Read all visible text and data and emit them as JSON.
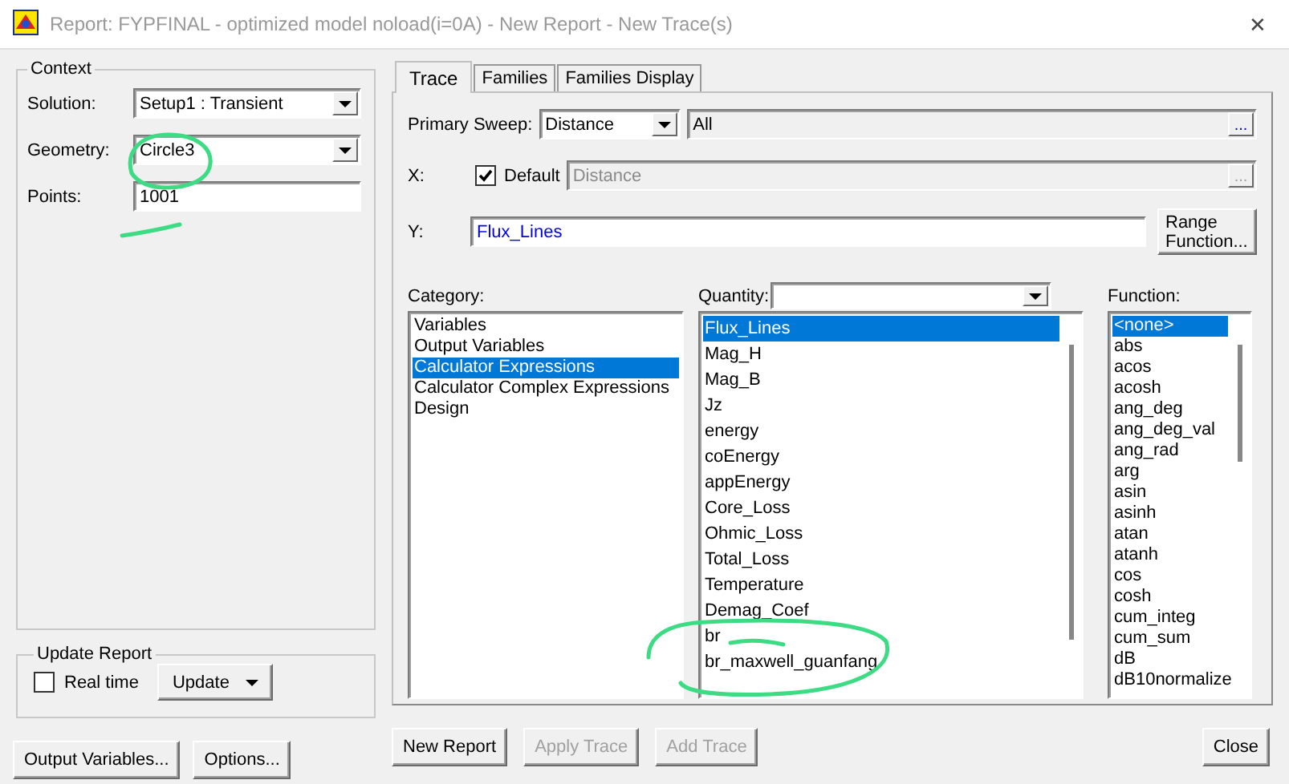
{
  "window": {
    "title": "Report: FYPFINAL - optimized model noload(i=0A) - New Report - New Trace(s)",
    "close": "✕"
  },
  "context": {
    "title": "Context",
    "fields": [
      {
        "label": "Solution:",
        "value": "Setup1 : Transient",
        "kind": "dropdown"
      },
      {
        "label": "Geometry:",
        "value": "Circle3",
        "kind": "dropdown"
      },
      {
        "label": "Points:",
        "value": "1001",
        "kind": "text"
      }
    ]
  },
  "update_report": {
    "title": "Update Report",
    "real_time": {
      "label": "Real time",
      "checked": false
    },
    "update_button": "Update"
  },
  "left_buttons": [
    "Output Variables...",
    "Options..."
  ],
  "tabs": [
    {
      "label": "Trace",
      "selected": true
    },
    {
      "label": "Families",
      "selected": false
    },
    {
      "label": "Families Display",
      "selected": false
    }
  ],
  "trace": {
    "primary_sweep": {
      "label": "Primary Sweep:",
      "value": "Distance",
      "range": "All",
      "browse": "..."
    },
    "x": {
      "label": "X:",
      "default": {
        "label": "Default",
        "checked": true
      },
      "value": "Distance",
      "browse": "..."
    },
    "y": {
      "label": "Y:",
      "value": "Flux_Lines",
      "range_button": "Range Function..."
    },
    "category": {
      "label": "Category:",
      "items": [
        {
          "label": "Variables",
          "selected": false
        },
        {
          "label": "Output Variables",
          "selected": false
        },
        {
          "label": "Calculator Expressions",
          "selected": true
        },
        {
          "label": "Calculator Complex Expressions",
          "selected": false
        },
        {
          "label": "Design",
          "selected": false
        }
      ]
    },
    "quantity": {
      "label": "Quantity:",
      "items": [
        {
          "label": "Flux_Lines",
          "selected": true
        },
        {
          "label": "Mag_H",
          "selected": false
        },
        {
          "label": "Mag_B",
          "selected": false
        },
        {
          "label": "Jz",
          "selected": false
        },
        {
          "label": "energy",
          "selected": false
        },
        {
          "label": "coEnergy",
          "selected": false
        },
        {
          "label": "appEnergy",
          "selected": false
        },
        {
          "label": "Core_Loss",
          "selected": false
        },
        {
          "label": "Ohmic_Loss",
          "selected": false
        },
        {
          "label": "Total_Loss",
          "selected": false
        },
        {
          "label": "Temperature",
          "selected": false
        },
        {
          "label": "Demag_Coef",
          "selected": false
        },
        {
          "label": "br",
          "selected": false
        },
        {
          "label": "br_maxwell_guanfang",
          "selected": false
        }
      ]
    },
    "function": {
      "label": "Function:",
      "items": [
        {
          "label": "<none>",
          "selected": true
        },
        {
          "label": "abs",
          "selected": false
        },
        {
          "label": "acos",
          "selected": false
        },
        {
          "label": "acosh",
          "selected": false
        },
        {
          "label": "ang_deg",
          "selected": false
        },
        {
          "label": "ang_deg_val",
          "selected": false
        },
        {
          "label": "ang_rad",
          "selected": false
        },
        {
          "label": "arg",
          "selected": false
        },
        {
          "label": "asin",
          "selected": false
        },
        {
          "label": "asinh",
          "selected": false
        },
        {
          "label": "atan",
          "selected": false
        },
        {
          "label": "atanh",
          "selected": false
        },
        {
          "label": "cos",
          "selected": false
        },
        {
          "label": "cosh",
          "selected": false
        },
        {
          "label": "cum_integ",
          "selected": false
        },
        {
          "label": "cum_sum",
          "selected": false
        },
        {
          "label": "dB",
          "selected": false
        },
        {
          "label": "dB10normalize",
          "selected": false
        }
      ]
    }
  },
  "bottom_buttons": [
    {
      "label": "New Report",
      "disabled": false
    },
    {
      "label": "Apply Trace",
      "disabled": true
    },
    {
      "label": "Add Trace",
      "disabled": true
    }
  ],
  "close_button": "Close"
}
